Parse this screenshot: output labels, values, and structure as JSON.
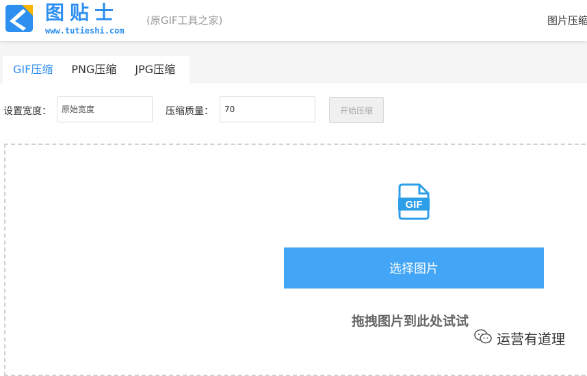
{
  "header": {
    "brand_name": "图贴士",
    "brand_url": "www.tutieshi.com",
    "brand_sub": "(原GIF工具之家)",
    "nav_right": "图片压缩",
    "logo_icon": "tutieshi-logo-icon"
  },
  "tabs": [
    {
      "label": "GIF压缩",
      "active": true
    },
    {
      "label": "PNG压缩",
      "active": false
    },
    {
      "label": "JPG压缩",
      "active": false
    }
  ],
  "settings": {
    "width_label": "设置宽度：",
    "width_placeholder": "原始宽度",
    "width_value": "",
    "quality_label": "压缩质量：",
    "quality_value": "70",
    "start_button": "开始压缩"
  },
  "upload": {
    "file_icon": "gif-file-icon",
    "file_icon_text": "GIF",
    "select_button": "选择图片",
    "hint": "拖拽图片到此处试试"
  },
  "watermark": {
    "icon": "wechat-icon",
    "text": "运营有道理"
  },
  "colors": {
    "accent": "#2d8ff0",
    "button_primary": "#42a5f5",
    "tab_band": "#f5f5f5"
  }
}
